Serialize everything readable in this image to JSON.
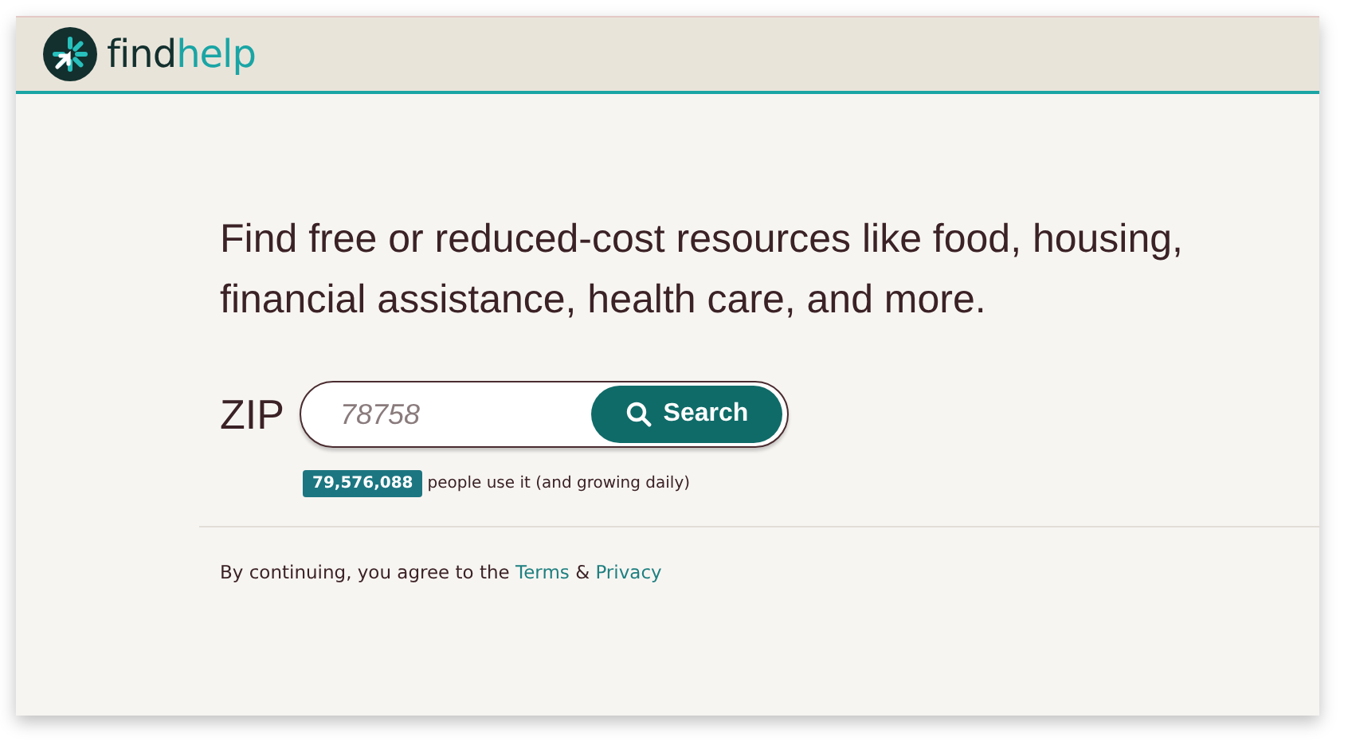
{
  "header": {
    "logo": {
      "parts": [
        "find",
        "help"
      ]
    }
  },
  "headline": "Find free or reduced-cost resources like food, housing, financial assistance, health care, and more.",
  "search": {
    "label": "ZIP",
    "placeholder": "78758",
    "button": "Search"
  },
  "stats": {
    "count": "79,576,088",
    "caption": "people use it (and growing daily)"
  },
  "footer": {
    "prefix": "By continuing, you agree to the",
    "links": [
      "Terms",
      "Privacy"
    ],
    "joiner": "&"
  }
}
